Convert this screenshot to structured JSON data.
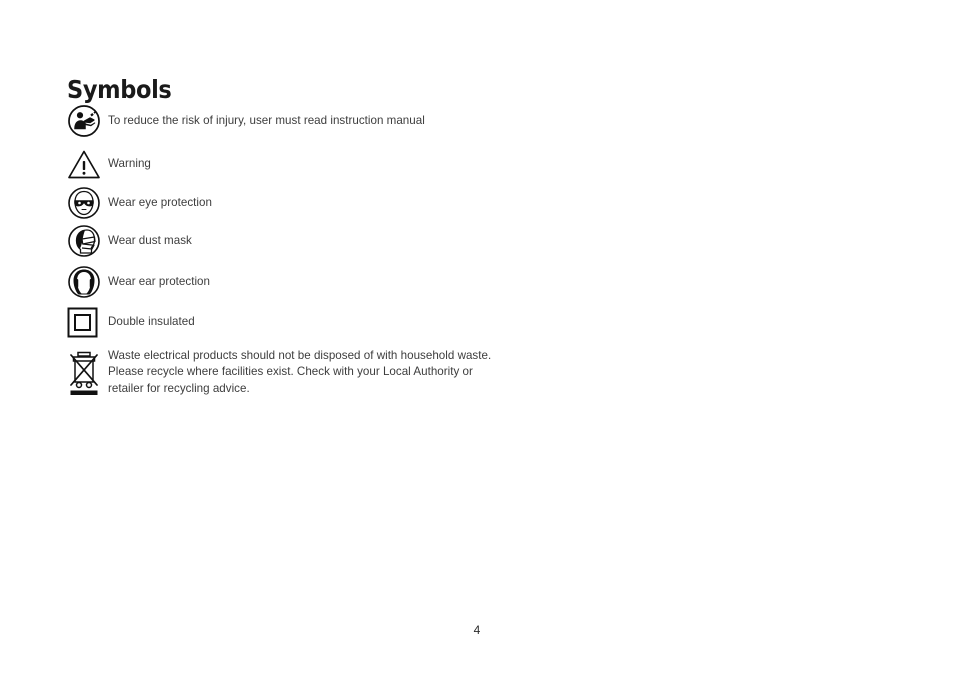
{
  "document": {
    "title": "Symbols",
    "page_number": "4"
  },
  "symbols": [
    {
      "icon": "read-instruction-manual-icon",
      "text": "To reduce the risk of injury, user must read instruction manual"
    },
    {
      "icon": "warning-triangle-icon",
      "text": "Warning"
    },
    {
      "icon": "wear-eye-protection-icon",
      "text": "Wear eye protection"
    },
    {
      "icon": "wear-dust-mask-icon",
      "text": "Wear dust mask"
    },
    {
      "icon": "wear-ear-protection-icon",
      "text": "Wear ear protection"
    },
    {
      "icon": "double-insulated-icon",
      "text": "Double insulated"
    },
    {
      "icon": "weee-crossed-out-wheelie-bin-icon",
      "text": "Waste electrical products should not be disposed of with household waste. Please recycle where facilities exist. Check with your Local Authority or retailer for recycling advice."
    }
  ],
  "colors": {
    "page_background": "#ffffff",
    "title_text": "#1a1a1a",
    "body_text": "#3d3d3d",
    "icon_ink": "#111111"
  }
}
